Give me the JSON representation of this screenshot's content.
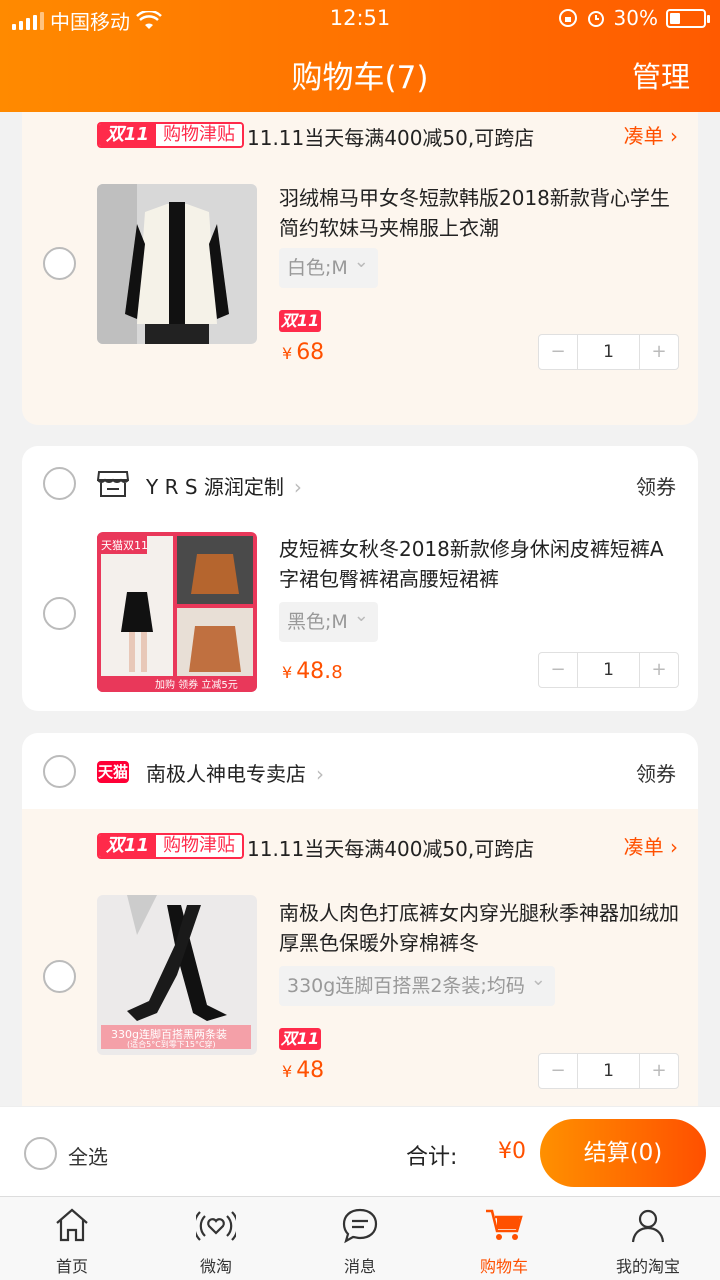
{
  "status_bar": {
    "carrier": "中国移动",
    "time": "12:51",
    "battery": "30%",
    "battery_level": 0.3
  },
  "header": {
    "title": "购物车(7)",
    "manage": "管理"
  },
  "promo": {
    "badge_left": "双11",
    "badge_right": "购物津贴",
    "text": "11.11当天每满400减50,可跨店",
    "link": "凑单 ›"
  },
  "items": [
    {
      "title": "羽绒棉马甲女冬短款韩版2018新款背心学生简约软妹马夹棉服上衣潮",
      "sku": "白色;M",
      "tag": "双11",
      "currency": "¥",
      "price": "68",
      "price_dec": "",
      "qty": "1"
    },
    {
      "title": "皮短裤女秋冬2018新款修身休闲皮裤短裤A字裙包臀裤裙高腰短裙裤",
      "sku": "黑色;M",
      "tag": "",
      "currency": "¥",
      "price": "48.",
      "price_dec": "8",
      "qty": "1"
    },
    {
      "title": "南极人肉色打底裤女内穿光腿秋季神器加绒加厚黑色保暖外穿棉裤冬",
      "sku": "330g连脚百搭黑2条装;均码",
      "tag": "双11",
      "currency": "¥",
      "price": "48",
      "price_dec": "",
      "qty": "1"
    }
  ],
  "thumbs": {
    "item2_banner_top": "天猫双11",
    "item2_banner_bottom": "加购 领券 立减5元",
    "item3_caption": "330g连脚百搭黑两条装",
    "item3_subcaption": "(适合5°C到零下15°C穿)"
  },
  "shops": [
    {
      "name": "Y R S 源润定制",
      "coupon": "领券",
      "icon": "store-icon"
    },
    {
      "name": "南极人神电专卖店",
      "coupon": "领券",
      "icon": "tmall-icon",
      "icon_text": "天猫"
    }
  ],
  "checkout": {
    "select_all": "全选",
    "total_label": "合计:",
    "total_value": "¥0",
    "pay_button": "结算(0)"
  },
  "tabs": [
    {
      "label": "首页",
      "icon": "home-icon"
    },
    {
      "label": "微淘",
      "icon": "weitao-icon"
    },
    {
      "label": "消息",
      "icon": "message-icon"
    },
    {
      "label": "购物车",
      "icon": "cart-icon",
      "active": true
    },
    {
      "label": "我的淘宝",
      "icon": "profile-icon"
    }
  ],
  "colors": {
    "accent": "#ff5000",
    "header_start": "#ff8a00",
    "header_end": "#ff5a00",
    "promo_red": "#ff2a4a",
    "card_tint": "#fdf6ee"
  }
}
